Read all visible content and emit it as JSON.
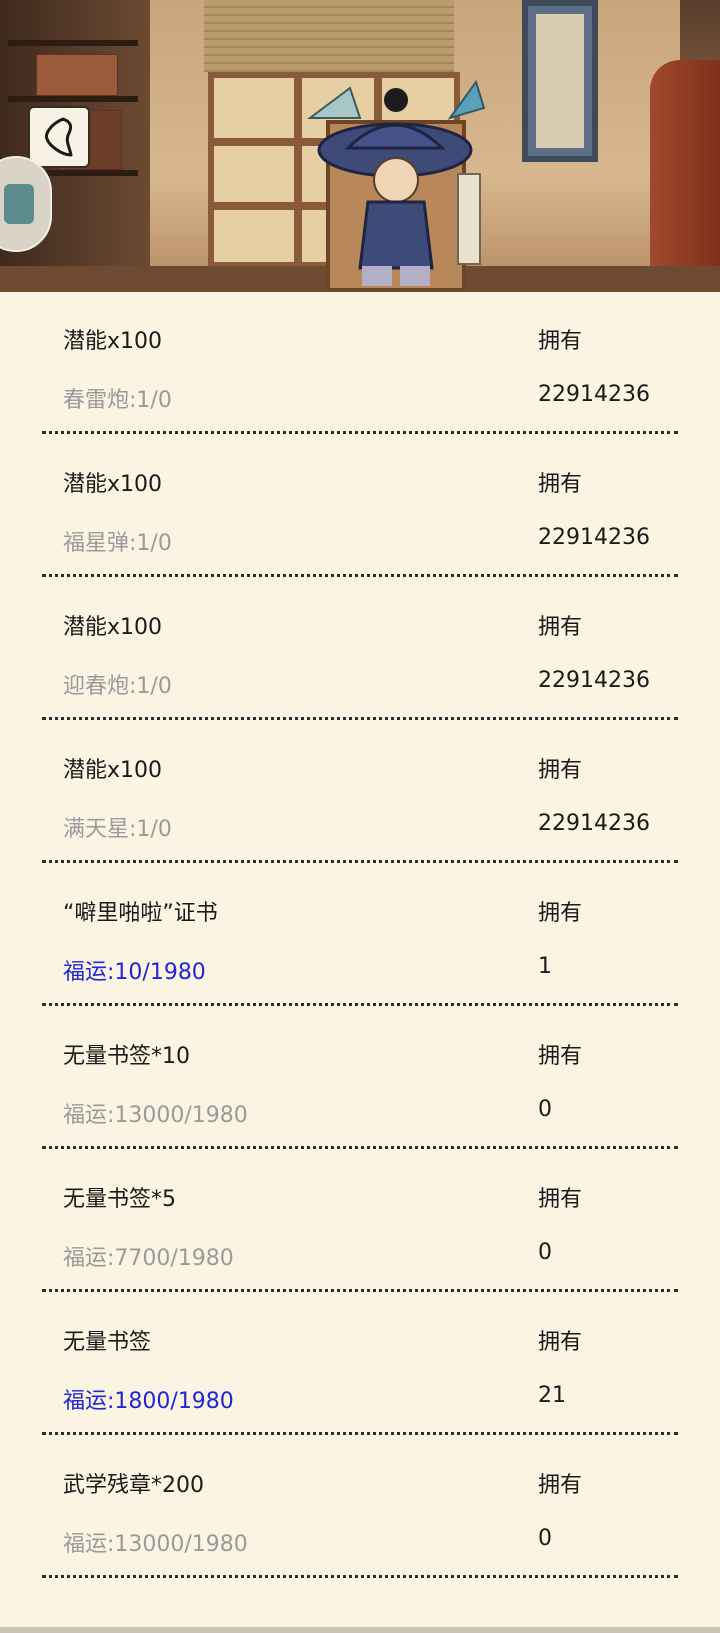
{
  "header": {
    "back_icon": "chevron-left-icon",
    "side_tab_icon": "panel-tab-icon"
  },
  "items": [
    {
      "name": "潜能x100",
      "own_label": "拥有",
      "cost": "春雷炮:1/0",
      "owned": "22914236",
      "affordable": false
    },
    {
      "name": "潜能x100",
      "own_label": "拥有",
      "cost": "福星弹:1/0",
      "owned": "22914236",
      "affordable": false
    },
    {
      "name": "潜能x100",
      "own_label": "拥有",
      "cost": "迎春炮:1/0",
      "owned": "22914236",
      "affordable": false
    },
    {
      "name": "潜能x100",
      "own_label": "拥有",
      "cost": "满天星:1/0",
      "owned": "22914236",
      "affordable": false
    },
    {
      "name": "“噼里啪啦”证书",
      "own_label": "拥有",
      "cost": "福运:10/1980",
      "owned": "1",
      "affordable": true
    },
    {
      "name": "无量书签*10",
      "own_label": "拥有",
      "cost": "福运:13000/1980",
      "owned": "0",
      "affordable": false
    },
    {
      "name": "无量书签*5",
      "own_label": "拥有",
      "cost": "福运:7700/1980",
      "owned": "0",
      "affordable": false
    },
    {
      "name": "无量书签",
      "own_label": "拥有",
      "cost": "福运:1800/1980",
      "owned": "21",
      "affordable": true
    },
    {
      "name": "武学残章*200",
      "own_label": "拥有",
      "cost": "福运:13000/1980",
      "owned": "0",
      "affordable": false
    }
  ],
  "colors": {
    "background": "#fbf4e3",
    "affordable_cost": "#1f26d6",
    "unaffordable_cost": "#9a9a9a",
    "text": "#1a1a1a"
  }
}
